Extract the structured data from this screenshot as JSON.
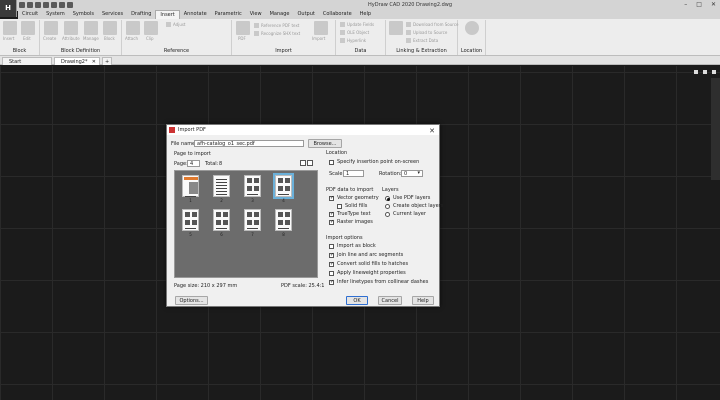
{
  "app": {
    "logo": "H",
    "title": "HyDraw CAD 2020   Drawing2.dwg",
    "window_controls": [
      "–",
      "□",
      "✕"
    ]
  },
  "menu": [
    "Circuit",
    "System",
    "Symbols",
    "Services",
    "Drafting",
    "Insert",
    "Annotate",
    "Parametric",
    "View",
    "Manage",
    "Output",
    "Collaborate",
    "Help"
  ],
  "ribbon": {
    "groups": [
      "Block",
      "Block Definition",
      "Reference",
      "Import",
      "Data",
      "Linking & Extraction",
      "Location"
    ],
    "buttons": [
      "Insert",
      "Edit",
      "Create",
      "Attribute",
      "Manage",
      "Block",
      "Attach",
      "Clip",
      "Adjust",
      "PDF",
      "Import",
      "Underlay",
      "OLE",
      "Field",
      "Data",
      "Link",
      "Geo"
    ],
    "small_items": [
      "Reference PDF text",
      "Recognize SHX text",
      "Update Fields",
      "OLE Object",
      "Hyperlink",
      "Download from Source",
      "Upload to Source",
      "Extract Data"
    ]
  },
  "doc_tabs": [
    "Start",
    "Drawing2*",
    "+"
  ],
  "dialog": {
    "title": "Import PDF",
    "file_name_label": "File name:",
    "file_name": "afh-catalog_o1_sec.pdf",
    "browse": "Browse...",
    "page_to_import": "Page to import",
    "page_label": "Page:",
    "page_value": "4",
    "total_label": "Total:",
    "total_value": "8",
    "thumbs": [
      "1",
      "2",
      "3",
      "4",
      "5",
      "6",
      "7",
      "8"
    ],
    "page_size": "Page size: 210 x 297 mm",
    "pdf_scale": "PDF scale: 25.4:1",
    "location": "Location",
    "specify_insertion": "Specify insertion point on-screen",
    "scale_label": "Scale:",
    "scale_value": "1",
    "rotation_label": "Rotation:",
    "rotation_value": "0",
    "pdf_data": "PDF data to import",
    "vector_geometry": "Vector geometry",
    "solid_fills": "Solid fills",
    "truetype_text": "TrueType text",
    "raster_images": "Raster images",
    "layers": "Layers",
    "use_pdf_layers": "Use PDF layers",
    "create_object_layers": "Create object layers",
    "current_layer": "Current layer",
    "import_options": "Import options",
    "import_as_block": "Import as block",
    "join_line_arc": "Join line and arc segments",
    "convert_solid_fills": "Convert solid fills to hatches",
    "apply_lineweight": "Apply lineweight properties",
    "infer_linetypes": "Infer linetypes from collinear dashes",
    "options_btn": "Options...",
    "ok_btn": "OK",
    "cancel_btn": "Cancel",
    "help_btn": "Help"
  }
}
